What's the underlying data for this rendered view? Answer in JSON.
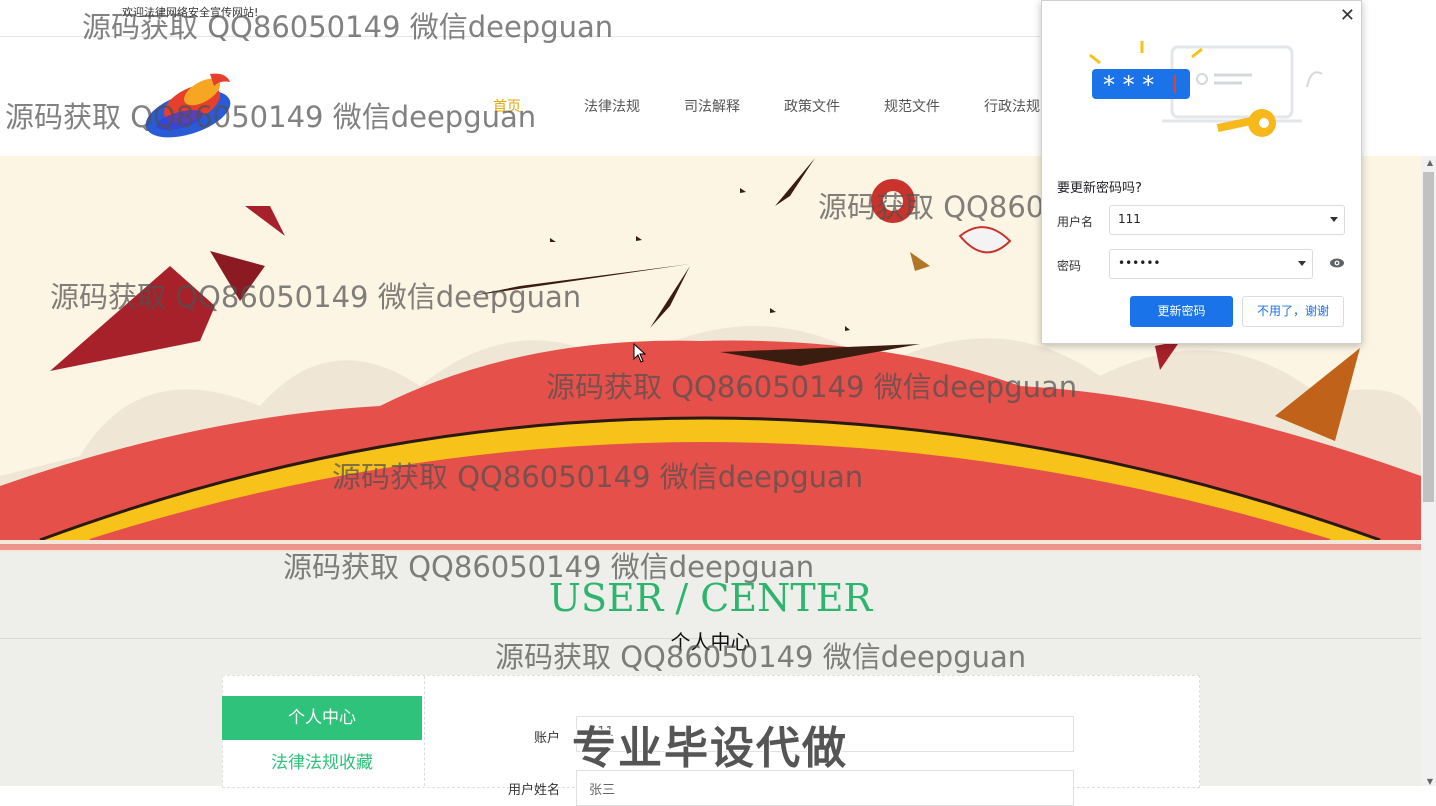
{
  "header": {
    "welcome": "欢迎法律网络安全宣传网站!",
    "nav": [
      {
        "label": "首页",
        "active": true
      },
      {
        "label": "法律法规"
      },
      {
        "label": "司法解释"
      },
      {
        "label": "政策文件"
      },
      {
        "label": "规范文件"
      },
      {
        "label": "行政法规"
      }
    ]
  },
  "section": {
    "title": "USER / CENTER",
    "subtitle": "个人中心"
  },
  "sidebar": {
    "active": "个人中心",
    "items": [
      "法律法规收藏"
    ]
  },
  "form": {
    "account_label": "账户",
    "account_value": "111",
    "name_label": "用户姓名",
    "name_value": "张三"
  },
  "password_popup": {
    "question": "要更新密码吗?",
    "username_label": "用户名",
    "username_value": "111",
    "password_label": "密码",
    "password_value": "••••••",
    "update_button": "更新密码",
    "decline_button": "不用了，谢谢",
    "masked_graphic": "* * *"
  },
  "watermarks": {
    "text": "源码获取 QQ86050149 微信deepguan",
    "stamp": "专业毕设代做"
  },
  "colors": {
    "accent_green": "#2ec27a",
    "nav_active": "#e5a400",
    "banner_bg": "#fdf5e4",
    "chrome_blue": "#1a73e8"
  }
}
